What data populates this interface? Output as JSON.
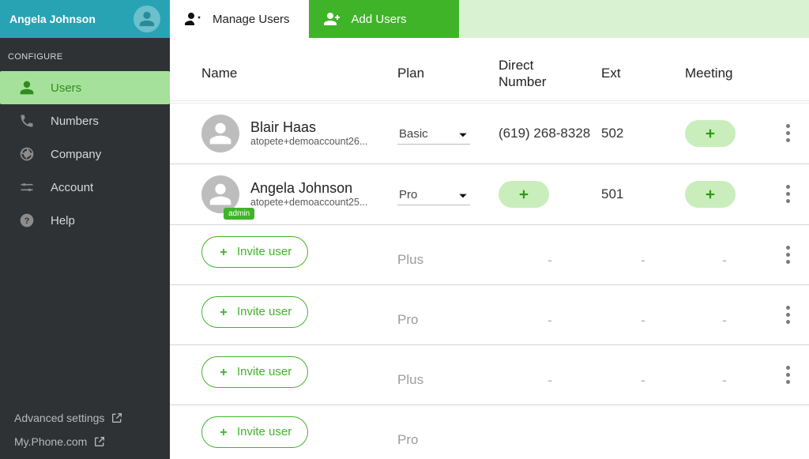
{
  "sidebar": {
    "user": "Angela Johnson",
    "section": "CONFIGURE",
    "items": [
      {
        "label": "Users",
        "icon": "user-icon"
      },
      {
        "label": "Numbers",
        "icon": "phone-icon"
      },
      {
        "label": "Company",
        "icon": "globe-icon"
      },
      {
        "label": "Account",
        "icon": "sliders-icon"
      },
      {
        "label": "Help",
        "icon": "help-icon"
      }
    ],
    "footer": [
      {
        "label": "Advanced settings"
      },
      {
        "label": "My.Phone.com"
      }
    ]
  },
  "tabs": {
    "manage": "Manage Users",
    "add": "Add Users"
  },
  "columns": {
    "name": "Name",
    "plan": "Plan",
    "direct": "Direct Number",
    "ext": "Ext",
    "meeting": "Meeting"
  },
  "users": [
    {
      "name": "Blair Haas",
      "email": "atopete+demoaccount26...",
      "plan": "Basic",
      "direct": "(619) 268-8328",
      "ext": "502",
      "admin": false,
      "has_direct": true
    },
    {
      "name": "Angela Johnson",
      "email": "atopete+demoaccount25...",
      "plan": "Pro",
      "direct": "",
      "ext": "501",
      "admin": true,
      "has_direct": false
    }
  ],
  "empty_rows": [
    {
      "plan": "Plus"
    },
    {
      "plan": "Pro"
    },
    {
      "plan": "Plus"
    },
    {
      "plan": "Pro"
    }
  ],
  "invite_label": "Invite user",
  "admin_badge": "admin"
}
